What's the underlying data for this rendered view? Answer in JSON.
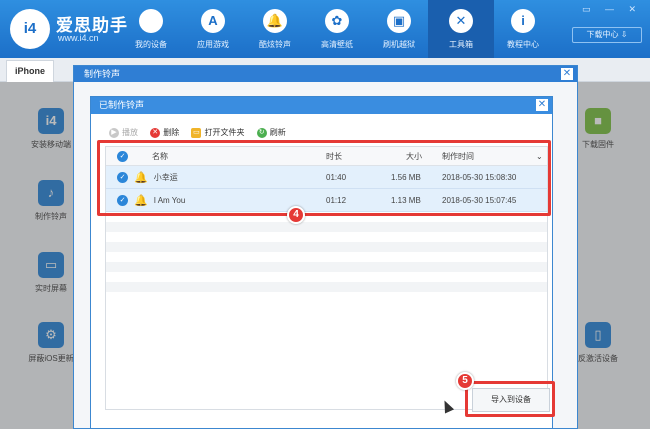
{
  "app": {
    "brand": "爱思助手",
    "url": "www.i4.cn",
    "logo": "i4",
    "download_center": "下载中心 ⇩"
  },
  "nav": [
    {
      "label": "我的设备",
      "icon": ""
    },
    {
      "label": "应用游戏",
      "icon": "A"
    },
    {
      "label": "酷炫铃声",
      "icon": "🔔"
    },
    {
      "label": "高清壁纸",
      "icon": "✿"
    },
    {
      "label": "刷机越狱",
      "icon": "▣"
    },
    {
      "label": "工具箱",
      "icon": "✕"
    },
    {
      "label": "教程中心",
      "icon": "i"
    }
  ],
  "tab": "iPhone",
  "left_tools": [
    {
      "label": "安装移动端",
      "icon": "i4"
    },
    {
      "label": "制作铃声",
      "icon": "♪"
    },
    {
      "label": "实时屏幕",
      "icon": "▭"
    },
    {
      "label": "屏蔽iOS更新",
      "icon": "⚙"
    }
  ],
  "right_tools": [
    {
      "label": "下载固件",
      "icon": "■"
    },
    {
      "label": "反激活设备",
      "icon": "▯"
    }
  ],
  "outer_dialog": {
    "title": "制作铃声"
  },
  "inner_dialog": {
    "title": "已制作铃声",
    "toolbar": {
      "play": "播放",
      "delete": "删除",
      "open_folder": "打开文件夹",
      "refresh": "刷新"
    },
    "columns": {
      "name": "名称",
      "duration": "时长",
      "size": "大小",
      "time": "制作时间"
    },
    "rows": [
      {
        "name": "小幸运",
        "duration": "01:40",
        "size": "1.56 MB",
        "time": "2018-05-30 15:08:30"
      },
      {
        "name": "I Am You",
        "duration": "01:12",
        "size": "1.13 MB",
        "time": "2018-05-30 15:07:45"
      }
    ],
    "import_button": "导入到设备"
  },
  "steps": {
    "four": "4",
    "five": "5"
  },
  "colors": {
    "accent": "#2b86d9",
    "highlight": "#e53935"
  }
}
